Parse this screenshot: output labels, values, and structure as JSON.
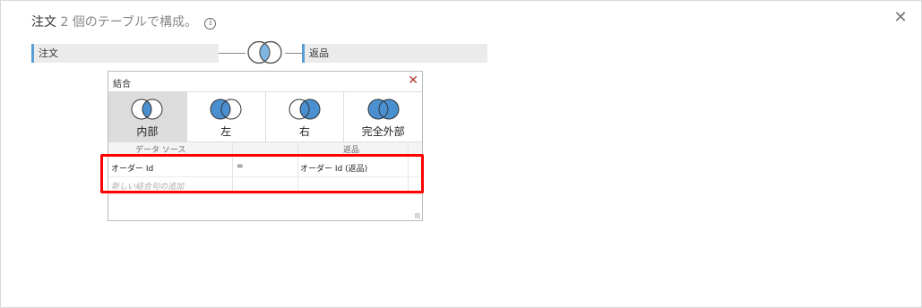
{
  "header": {
    "title_prefix": "注文",
    "title_count": "2 個のテーブルで構成。",
    "info_icon": "info-circle-icon",
    "close_icon": "close-icon"
  },
  "canvas": {
    "left_table": "注文",
    "right_table": "返品",
    "join_node_icon": "inner-join-venn-icon"
  },
  "join_dialog": {
    "title": "結合",
    "close_icon": "close-icon",
    "types": [
      {
        "label": "内部",
        "icon": "inner-join-icon",
        "selected": true
      },
      {
        "label": "左",
        "icon": "left-join-icon",
        "selected": false
      },
      {
        "label": "右",
        "icon": "right-join-icon",
        "selected": false
      },
      {
        "label": "完全外部",
        "icon": "full-outer-join-icon",
        "selected": false
      }
    ],
    "columns": {
      "left": "データ ソース",
      "right": "返品"
    },
    "clause": {
      "left_field": "オーダー Id",
      "operator": "=",
      "right_field": "オーダー Id (返品)"
    },
    "add_clause": "新しい結合句の追加"
  },
  "colors": {
    "accent": "#5a9ed6",
    "venn_fill": "#4a90d0",
    "highlight": "#ff0000"
  }
}
